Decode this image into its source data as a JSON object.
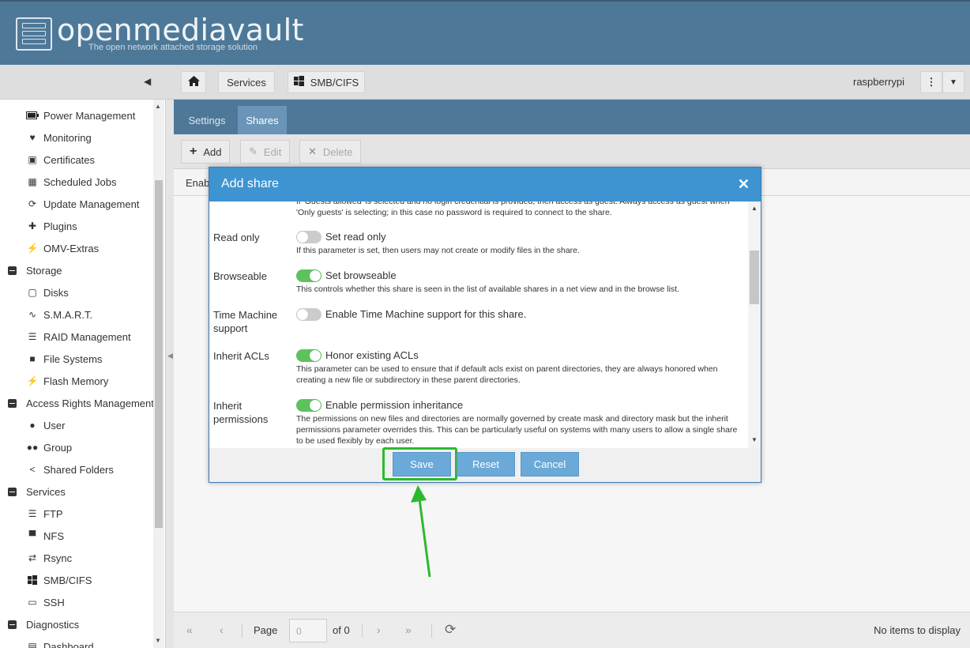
{
  "header": {
    "logo_text": "openmediavault",
    "tagline": "The open network attached storage solution"
  },
  "navbar": {
    "breadcrumbs": [
      "Services",
      "SMB/CIFS"
    ],
    "user": "raspberrypi"
  },
  "sidebar": {
    "items": [
      {
        "label": "Power Management",
        "icon": "battery-icon",
        "group": false
      },
      {
        "label": "Monitoring",
        "icon": "heartbeat-icon",
        "group": false
      },
      {
        "label": "Certificates",
        "icon": "certificate-icon",
        "group": false
      },
      {
        "label": "Scheduled Jobs",
        "icon": "calendar-clock-icon",
        "group": false
      },
      {
        "label": "Update Management",
        "icon": "refresh-icon",
        "group": false
      },
      {
        "label": "Plugins",
        "icon": "puzzle-icon",
        "group": false
      },
      {
        "label": "OMV-Extras",
        "icon": "plug-icon",
        "group": false
      },
      {
        "label": "Storage",
        "icon": "minus-square-icon",
        "group": true
      },
      {
        "label": "Disks",
        "icon": "disk-icon",
        "group": false
      },
      {
        "label": "S.M.A.R.T.",
        "icon": "pulse-icon",
        "group": false
      },
      {
        "label": "RAID Management",
        "icon": "database-icon",
        "group": false
      },
      {
        "label": "File Systems",
        "icon": "folders-icon",
        "group": false
      },
      {
        "label": "Flash Memory",
        "icon": "bolt-icon",
        "group": false
      },
      {
        "label": "Access Rights Management",
        "icon": "minus-square-icon",
        "group": true
      },
      {
        "label": "User",
        "icon": "user-icon",
        "group": false
      },
      {
        "label": "Group",
        "icon": "users-icon",
        "group": false
      },
      {
        "label": "Shared Folders",
        "icon": "share-icon",
        "group": false
      },
      {
        "label": "Services",
        "icon": "minus-square-icon",
        "group": true
      },
      {
        "label": "FTP",
        "icon": "server-icon",
        "group": false
      },
      {
        "label": "NFS",
        "icon": "network-drive-icon",
        "group": false
      },
      {
        "label": "Rsync",
        "icon": "sync-icon",
        "group": false
      },
      {
        "label": "SMB/CIFS",
        "icon": "windows-icon",
        "group": false
      },
      {
        "label": "SSH",
        "icon": "terminal-icon",
        "group": false
      },
      {
        "label": "Diagnostics",
        "icon": "minus-square-icon",
        "group": true
      },
      {
        "label": "Dashboard",
        "icon": "dashboard-icon",
        "group": false
      }
    ]
  },
  "tabs": [
    {
      "label": "Settings",
      "active": false
    },
    {
      "label": "Shares",
      "active": true
    }
  ],
  "toolbar": {
    "add": "Add",
    "edit": "Edit",
    "delete": "Delete"
  },
  "grid": {
    "first_column": "Enab"
  },
  "pager": {
    "page_label": "Page",
    "page_value": "0",
    "of_label": "of 0",
    "status": "No items to display"
  },
  "modal": {
    "title": "Add share",
    "fields": {
      "guest_help_partial": "If 'Guests allowed' is selected and no login credential is provided, then access as guest. Always access as guest when 'Only guests' is selecting; in this case no password is required to connect to the share.",
      "read_only": {
        "label": "Read only",
        "toggle_label": "Set read only",
        "on": false,
        "help": "If this parameter is set, then users may not create or modify files in the share."
      },
      "browseable": {
        "label": "Browseable",
        "toggle_label": "Set browseable",
        "on": true,
        "help": "This controls whether this share is seen in the list of available shares in a net view and in the browse list."
      },
      "time_machine": {
        "label_line1": "Time Machine",
        "label_line2": "support",
        "toggle_label": "Enable Time Machine support for this share.",
        "on": false
      },
      "inherit_acls": {
        "label": "Inherit ACLs",
        "toggle_label": "Honor existing ACLs",
        "on": true,
        "help": "This parameter can be used to ensure that if default acls exist on parent directories, they are always honored when creating a new file or subdirectory in these parent directories."
      },
      "inherit_perms": {
        "label_line1": "Inherit",
        "label_line2": "permissions",
        "toggle_label": "Enable permission inheritance",
        "on": true,
        "help": "The permissions on new files and directories are normally governed by create mask and directory mask but the inherit permissions parameter overrides this. This can be particularly useful on systems with many users to allow a single share to be used flexibly by each user."
      }
    },
    "buttons": {
      "save": "Save",
      "reset": "Reset",
      "cancel": "Cancel"
    }
  },
  "colors": {
    "header": "#4e7898",
    "modal_header": "#3e94d1",
    "toggle_on": "#5dc25d",
    "button": "#6aa9d8",
    "highlight": "#2db92d"
  }
}
